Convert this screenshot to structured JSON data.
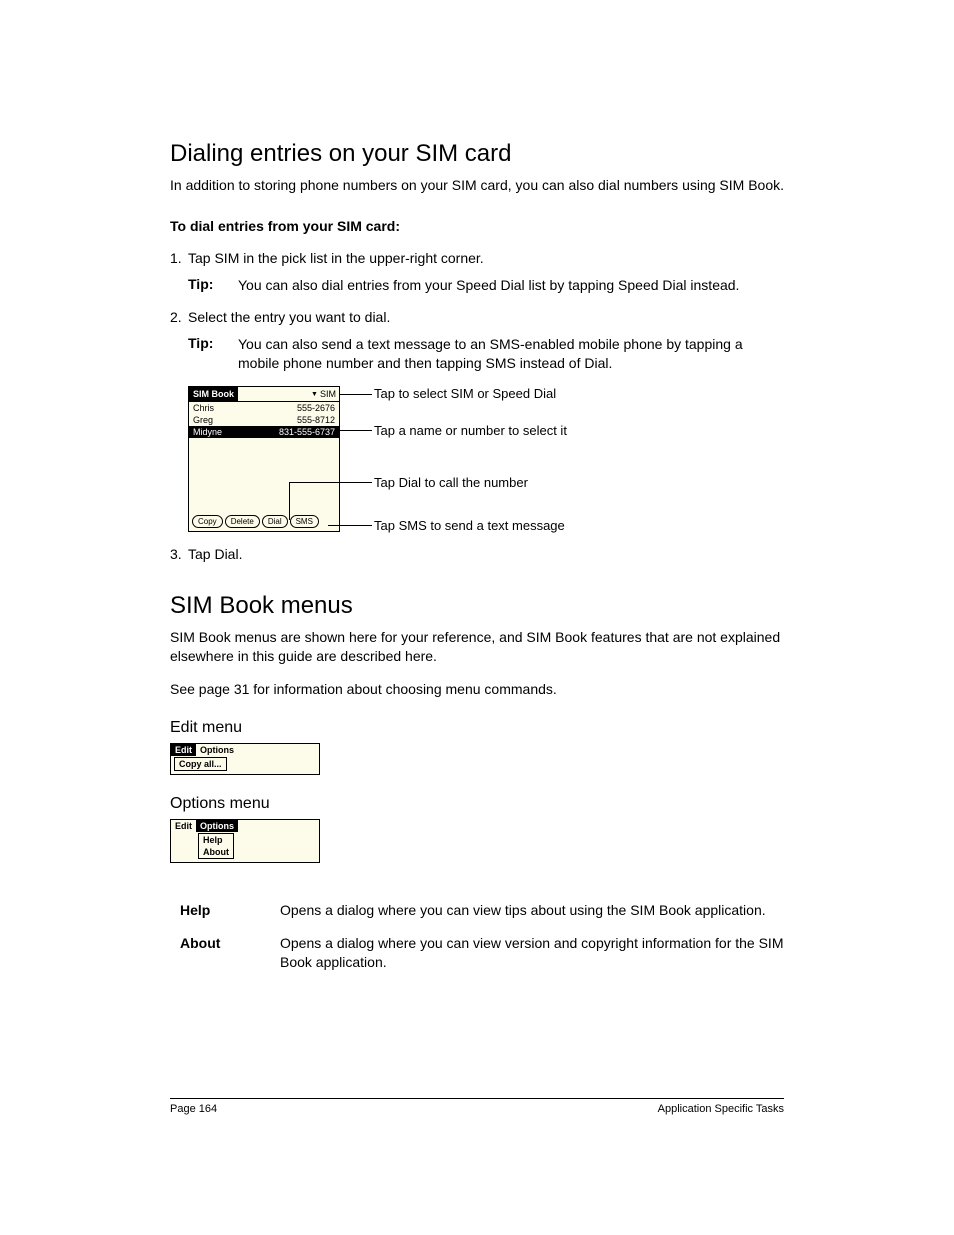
{
  "section1": {
    "heading": "Dialing entries on your SIM card",
    "intro": "In addition to storing phone numbers on your SIM card, you can also dial numbers using SIM Book.",
    "procedure_title": "To dial entries from your SIM card:",
    "steps": [
      {
        "num": "1.",
        "text": "Tap SIM in the pick list in the upper-right corner.",
        "tip_label": "Tip:",
        "tip_text": "You can also dial entries from your Speed Dial list by tapping Speed Dial instead."
      },
      {
        "num": "2.",
        "text": "Select the entry you want to dial.",
        "tip_label": "Tip:",
        "tip_text": "You can also send a text message to an SMS-enabled mobile phone by tapping a mobile phone number and then tapping SMS instead of Dial."
      },
      {
        "num": "3.",
        "text": "Tap Dial."
      }
    ]
  },
  "simbook": {
    "title": "SIM Book",
    "picker": "SIM",
    "rows": [
      {
        "name": "Chris",
        "number": "555-2676"
      },
      {
        "name": "Greg",
        "number": "555-8712"
      },
      {
        "name": "Midyne",
        "number": "831-555-6737"
      }
    ],
    "buttons": [
      "Copy",
      "Delete",
      "Dial",
      "SMS"
    ],
    "callouts": [
      "Tap to select SIM or Speed Dial",
      "Tap a name or number to select it",
      "Tap Dial to call the number",
      "Tap SMS to send a text message"
    ]
  },
  "section2": {
    "heading": "SIM Book menus",
    "para1": "SIM Book menus are shown here for your reference, and SIM Book features that are not explained elsewhere in this guide are described here.",
    "para2": "See page 31 for information about choosing menu commands.",
    "edit_heading": "Edit menu",
    "edit_menu_items": {
      "bar": [
        "Edit",
        "Options"
      ],
      "drop": [
        "Copy all..."
      ]
    },
    "options_heading": "Options menu",
    "options_menu_items": {
      "bar": [
        "Edit",
        "Options"
      ],
      "drop": [
        "Help",
        "About"
      ]
    },
    "defs": [
      {
        "term": "Help",
        "text": "Opens a dialog where you can view tips about using the SIM Book application."
      },
      {
        "term": "About",
        "text": "Opens a dialog where you can view version and copyright information for the SIM Book application."
      }
    ]
  },
  "footer": {
    "left": "Page 164",
    "right": "Application Specific Tasks"
  }
}
